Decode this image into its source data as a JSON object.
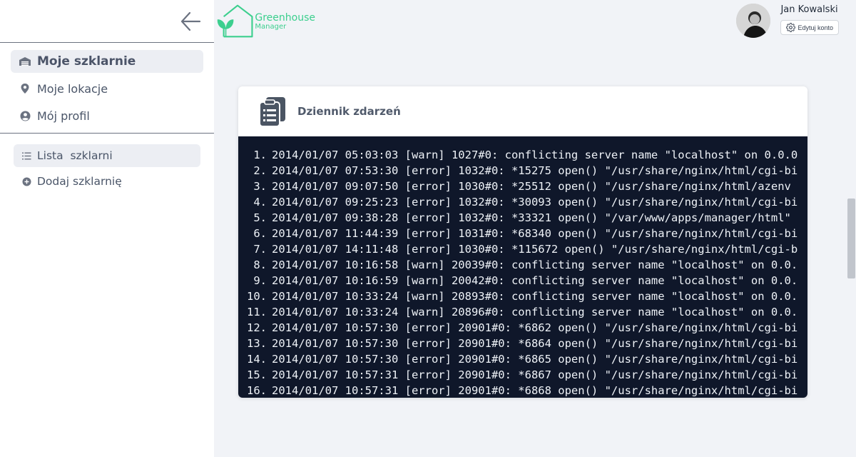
{
  "brand": {
    "title": "Greenhouse",
    "subtitle": "Manager",
    "color": "#3ccf8e"
  },
  "nav": {
    "main": [
      {
        "label": "Moje szklarnie",
        "icon": "warehouse-icon",
        "active": true
      },
      {
        "label": "Moje lokacje",
        "icon": "map-pin-icon",
        "active": false
      },
      {
        "label": "Mój profil",
        "icon": "user-circle-icon",
        "active": false
      }
    ],
    "sub": [
      {
        "label": "Lista  szklarni",
        "icon": "list-icon",
        "active": true
      },
      {
        "label": "Dodaj szklarnię",
        "icon": "plus-circle-icon",
        "active": false
      }
    ]
  },
  "user": {
    "name": "Jan Kowalski",
    "edit_label": "Edytuj konto"
  },
  "event_log": {
    "title": "Dziennik zdarzeń",
    "lines": [
      {
        "n": "1.",
        "text": "2014/01/07 05:03:03 [warn] 1027#0: conflicting server name \"localhost\" on 0.0.0"
      },
      {
        "n": "2.",
        "text": "2014/01/07 07:53:30 [error] 1032#0: *15275 open() \"/usr/share/nginx/html/cgi-bi"
      },
      {
        "n": "3.",
        "text": "2014/01/07 09:07:50 [error] 1030#0: *25512 open() \"/usr/share/nginx/html/azenv"
      },
      {
        "n": "4.",
        "text": "2014/01/07 09:25:23 [error] 1032#0: *30093 open() \"/usr/share/nginx/html/cgi-bi"
      },
      {
        "n": "5.",
        "text": "2014/01/07 09:38:28 [error] 1032#0: *33321 open() \"/var/www/apps/manager/html\""
      },
      {
        "n": "6.",
        "text": "2014/01/07 11:44:39 [error] 1031#0: *68340 open() \"/usr/share/nginx/html/cgi-bi"
      },
      {
        "n": "7.",
        "text": "2014/01/07 14:11:48 [error] 1030#0: *115672 open() \"/usr/share/nginx/html/cgi-b"
      },
      {
        "n": "8.",
        "text": "2014/01/07 10:16:58 [warn] 20039#0: conflicting server name \"localhost\" on 0.0."
      },
      {
        "n": "9.",
        "text": "2014/01/07 10:16:59 [warn] 20042#0: conflicting server name \"localhost\" on 0.0."
      },
      {
        "n": "10.",
        "text": "2014/01/07 10:33:24 [warn] 20893#0: conflicting server name \"localhost\" on 0.0."
      },
      {
        "n": "11.",
        "text": "2014/01/07 10:33:24 [warn] 20896#0: conflicting server name \"localhost\" on 0.0."
      },
      {
        "n": "12.",
        "text": "2014/01/07 10:57:30 [error] 20901#0: *6862 open() \"/usr/share/nginx/html/cgi-bi"
      },
      {
        "n": "13.",
        "text": "2014/01/07 10:57:30 [error] 20901#0: *6864 open() \"/usr/share/nginx/html/cgi-bi"
      },
      {
        "n": "14.",
        "text": "2014/01/07 10:57:30 [error] 20901#0: *6865 open() \"/usr/share/nginx/html/cgi-bi"
      },
      {
        "n": "15.",
        "text": "2014/01/07 10:57:31 [error] 20901#0: *6867 open() \"/usr/share/nginx/html/cgi-bi"
      },
      {
        "n": "16.",
        "text": "2014/01/07 10:57:31 [error] 20901#0: *6868 open() \"/usr/share/nginx/html/cgi-bi"
      }
    ]
  },
  "icons": {
    "back": "arrow-left-icon",
    "settings": "gear-icon",
    "log": "clipboard-list-icon"
  }
}
